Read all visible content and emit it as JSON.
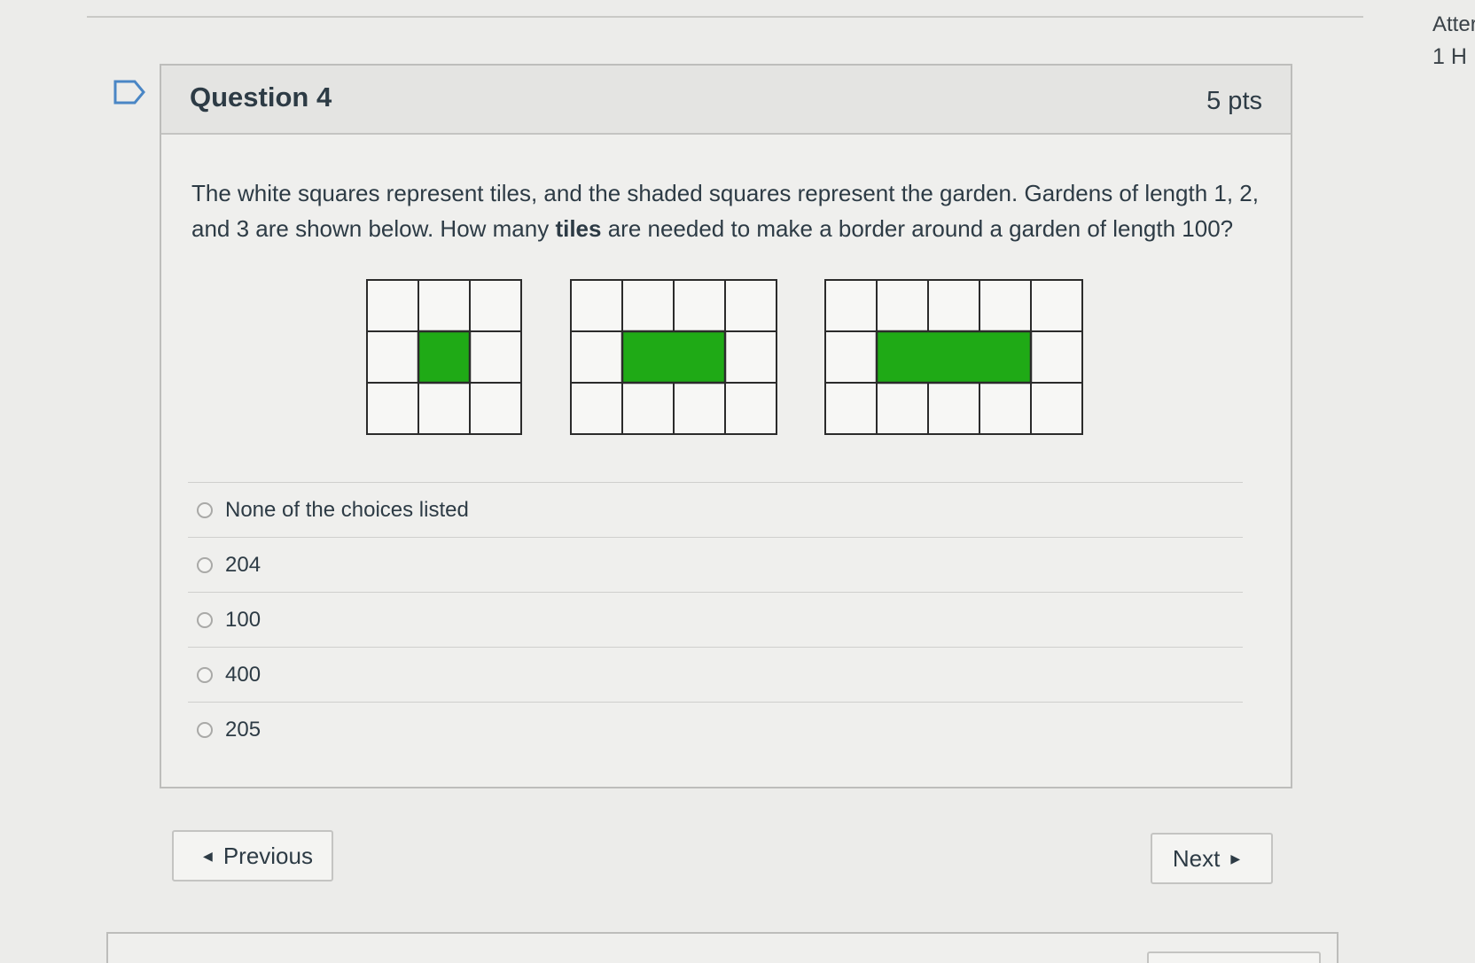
{
  "side": {
    "line1": "Atter",
    "line2": "1 H"
  },
  "question": {
    "title": "Question 4",
    "points": "5 pts",
    "text_before": "The white squares represent tiles, and the shaded squares represent the garden. Gardens of length 1, 2, and 3 are shown below. How many ",
    "text_bold": "tiles",
    "text_after": " are needed to make a border around a garden of length 100?"
  },
  "diagrams": [
    {
      "garden_length": 1
    },
    {
      "garden_length": 2
    },
    {
      "garden_length": 3
    }
  ],
  "colors": {
    "garden": "#1faa16",
    "tile_border": "#2b2b2b",
    "tile_fill": "#f7f7f5"
  },
  "answers": [
    {
      "label": "None of the choices listed"
    },
    {
      "label": "204"
    },
    {
      "label": "100"
    },
    {
      "label": "400"
    },
    {
      "label": "205"
    }
  ],
  "nav": {
    "previous_label": "Previous",
    "next_label": "Next"
  }
}
